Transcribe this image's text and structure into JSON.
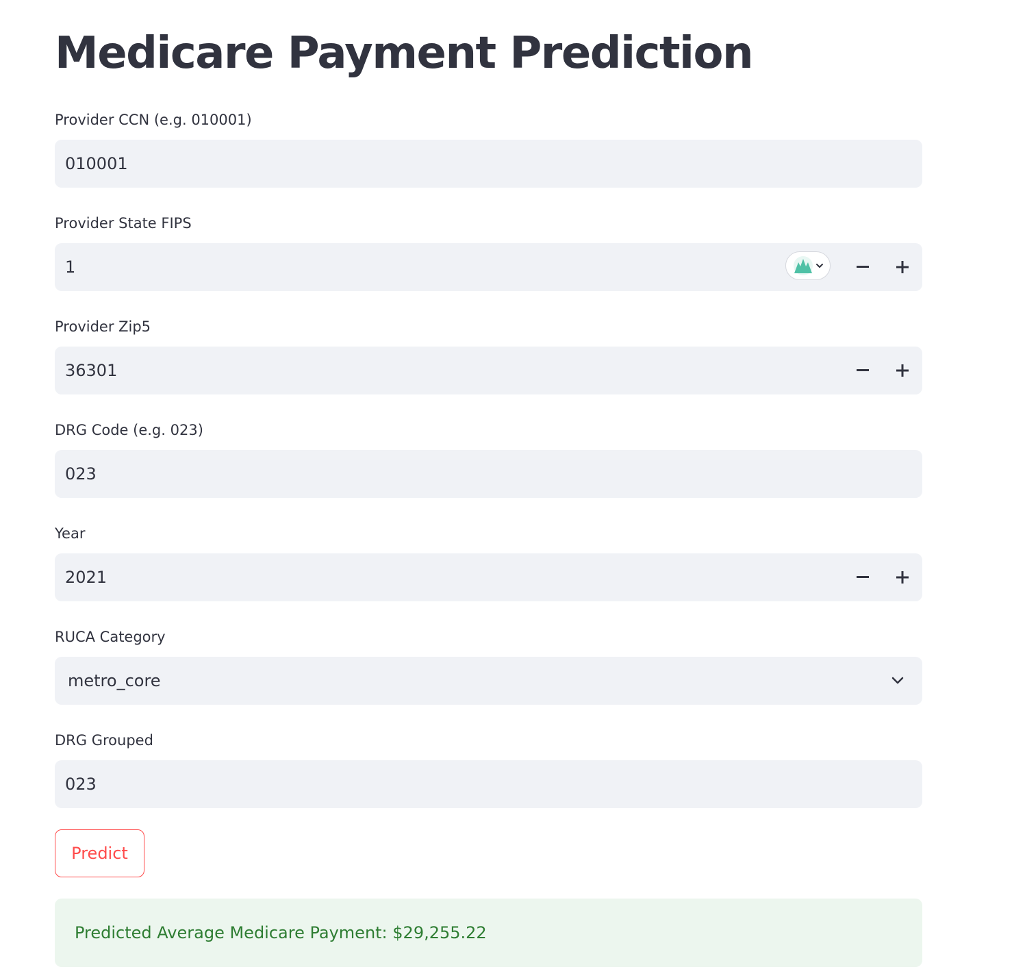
{
  "page": {
    "title": "Medicare Payment Prediction"
  },
  "form": {
    "provider_ccn": {
      "label": "Provider CCN (e.g. 010001)",
      "value": "010001"
    },
    "provider_state_fips": {
      "label": "Provider State FIPS",
      "value": "1",
      "decrement_icon": "minus-icon",
      "increment_icon": "plus-icon"
    },
    "provider_zip5": {
      "label": "Provider Zip5",
      "value": "36301",
      "decrement_icon": "minus-icon",
      "increment_icon": "plus-icon"
    },
    "drg_code": {
      "label": "DRG Code (e.g. 023)",
      "value": "023"
    },
    "year": {
      "label": "Year",
      "value": "2021",
      "decrement_icon": "minus-icon",
      "increment_icon": "plus-icon"
    },
    "ruca_category": {
      "label": "RUCA Category",
      "selected": "metro_core",
      "icon": "chevron-down-icon"
    },
    "drg_grouped": {
      "label": "DRG Grouped",
      "value": "023"
    }
  },
  "actions": {
    "predict_label": "Predict"
  },
  "result": {
    "text": "Predicted Average Medicare Payment: $29,255.22"
  },
  "theme": {
    "primary": "#ff4b4b",
    "text": "#31333f",
    "input_bg": "#f0f2f6",
    "success_bg": "#ecf6ee",
    "success_text": "#2e7d32",
    "extension_icon_color": "#4fc1a6"
  },
  "icons": {
    "extension": "extension-badge-icon"
  }
}
